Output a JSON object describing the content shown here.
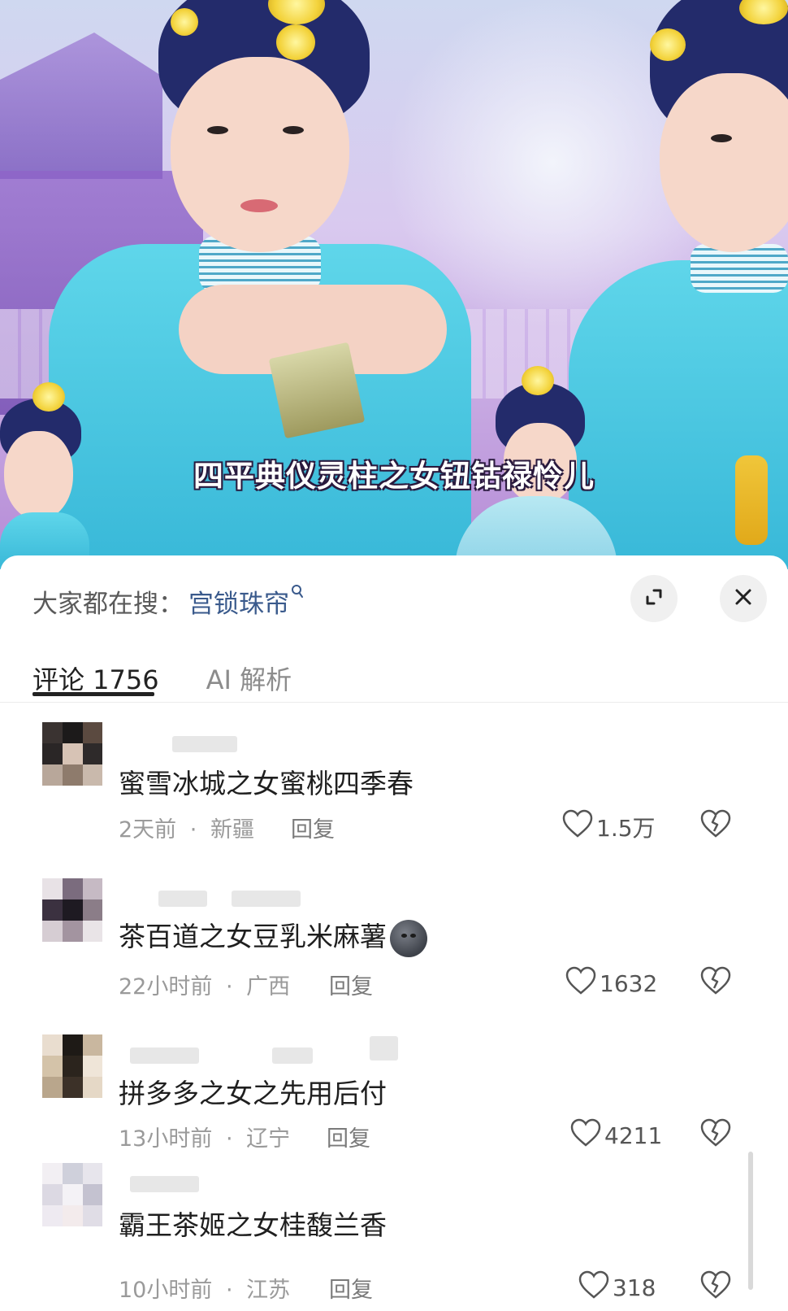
{
  "video": {
    "subtitle": "四平典仪灵柱之女钮钴禄怜儿"
  },
  "search_bar": {
    "prefix": "大家都在搜：",
    "query": "宫锁珠帘",
    "search_icon": "search-icon",
    "expand_icon": "expand-icon",
    "close_icon": "close-icon"
  },
  "tabs": [
    {
      "label": "评论 1756",
      "active": true
    },
    {
      "label": "AI 解析",
      "active": false
    }
  ],
  "comments": [
    {
      "text": "蜜雪冰城之女蜜桃四季春",
      "time": "2天前",
      "location": "新疆",
      "reply": "回复",
      "likes": "1.5万",
      "emoji": ""
    },
    {
      "text": "茶百道之女豆乳米麻薯",
      "time": "22小时前",
      "location": "广西",
      "reply": "回复",
      "likes": "1632",
      "emoji": "dark-moon-face-emoji"
    },
    {
      "text": "拼多多之女之先用后付",
      "time": "13小时前",
      "location": "辽宁",
      "reply": "回复",
      "likes": "4211",
      "emoji": ""
    },
    {
      "text": "霸王茶姬之女桂馥兰香",
      "time": "10小时前",
      "location": "江苏",
      "reply": "回复",
      "likes": "318",
      "emoji": ""
    }
  ],
  "meta_separator": "·",
  "colors": {
    "link": "#3a5a8c",
    "muted": "#9a9a9a",
    "text": "#1f1f1f"
  }
}
